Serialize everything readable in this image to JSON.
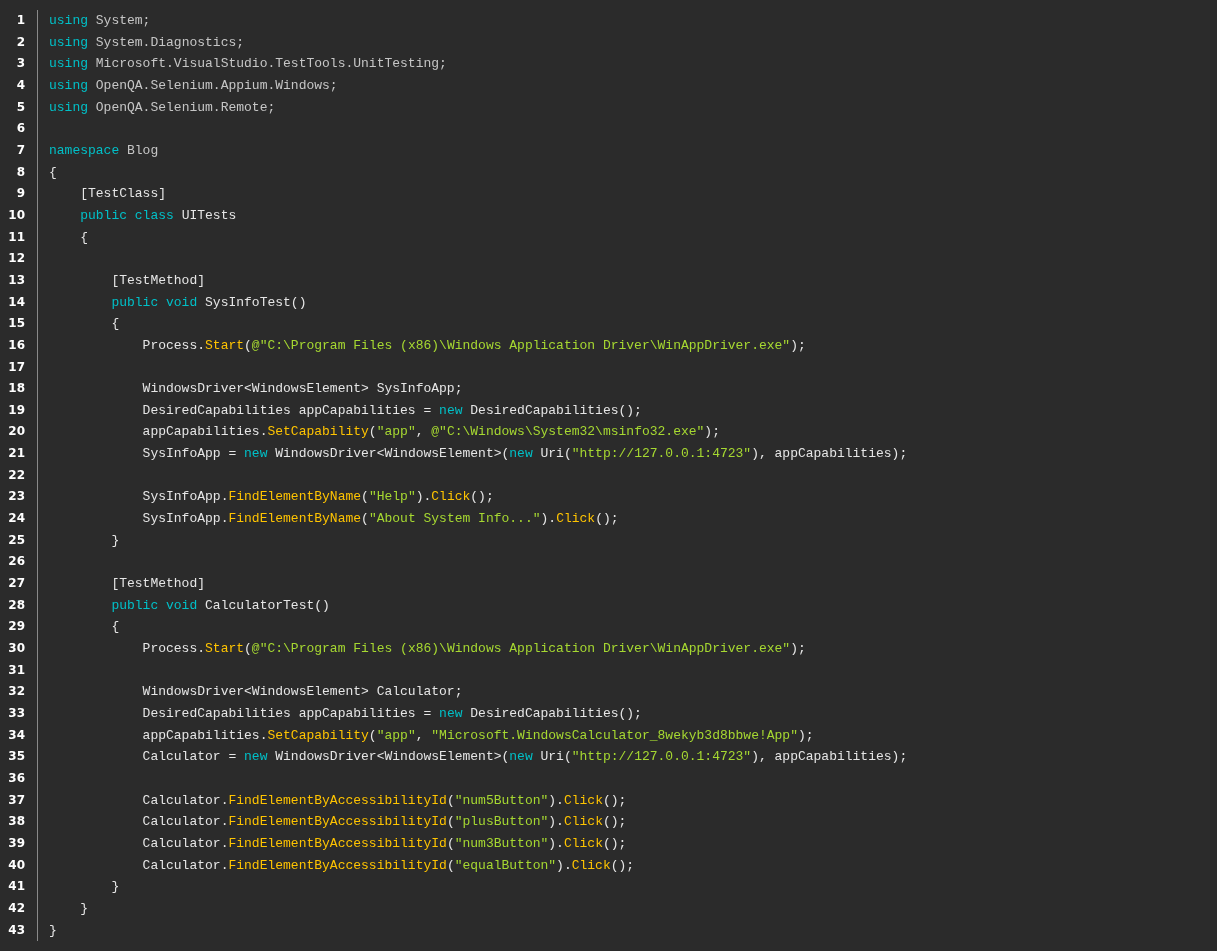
{
  "editor": {
    "lines": [
      {
        "number": "1",
        "tokens": [
          {
            "kind": "keyword",
            "text": "using"
          },
          {
            "kind": "name",
            "text": " System;"
          }
        ]
      },
      {
        "number": "2",
        "tokens": [
          {
            "kind": "keyword",
            "text": "using"
          },
          {
            "kind": "name",
            "text": " System.Diagnostics;"
          }
        ]
      },
      {
        "number": "3",
        "tokens": [
          {
            "kind": "keyword",
            "text": "using"
          },
          {
            "kind": "name",
            "text": " Microsoft.VisualStudio.TestTools.UnitTesting;"
          }
        ]
      },
      {
        "number": "4",
        "tokens": [
          {
            "kind": "keyword",
            "text": "using"
          },
          {
            "kind": "name",
            "text": " OpenQA.Selenium.Appium.Windows;"
          }
        ]
      },
      {
        "number": "5",
        "tokens": [
          {
            "kind": "keyword",
            "text": "using"
          },
          {
            "kind": "name",
            "text": " OpenQA.Selenium.Remote;"
          }
        ]
      },
      {
        "number": "6"
      },
      {
        "number": "7",
        "tokens": [
          {
            "kind": "keyword",
            "text": "namespace"
          },
          {
            "kind": "name",
            "text": " Blog"
          }
        ]
      },
      {
        "number": "8",
        "tokens": [
          {
            "kind": "text",
            "text": "{"
          }
        ]
      },
      {
        "number": "9",
        "tokens": [
          {
            "kind": "text",
            "text": "    [TestClass]"
          }
        ]
      },
      {
        "number": "10",
        "tokens": [
          {
            "kind": "keyword",
            "text": "    public class"
          },
          {
            "kind": "text",
            "text": " UITests"
          }
        ]
      },
      {
        "number": "11",
        "tokens": [
          {
            "kind": "text",
            "text": "    {"
          }
        ]
      },
      {
        "number": "12"
      },
      {
        "number": "13",
        "tokens": [
          {
            "kind": "text",
            "text": "        [TestMethod]"
          }
        ]
      },
      {
        "number": "14",
        "tokens": [
          {
            "kind": "keyword",
            "text": "        public void"
          },
          {
            "kind": "text",
            "text": " SysInfoTest()"
          }
        ]
      },
      {
        "number": "15",
        "tokens": [
          {
            "kind": "text",
            "text": "        {"
          }
        ]
      },
      {
        "number": "16",
        "tokens": [
          {
            "kind": "text",
            "text": "            Process."
          },
          {
            "kind": "method",
            "text": "Start"
          },
          {
            "kind": "text",
            "text": "("
          },
          {
            "kind": "string",
            "text": "@\"C:\\Program Files (x86)\\Windows Application Driver\\WinAppDriver.exe\""
          },
          {
            "kind": "text",
            "text": ");"
          }
        ]
      },
      {
        "number": "17"
      },
      {
        "number": "18",
        "tokens": [
          {
            "kind": "text",
            "text": "            WindowsDriver<WindowsElement> SysInfoApp;"
          }
        ]
      },
      {
        "number": "19",
        "tokens": [
          {
            "kind": "text",
            "text": "            DesiredCapabilities appCapabilities = "
          },
          {
            "kind": "keyword",
            "text": "new"
          },
          {
            "kind": "text",
            "text": " DesiredCapabilities();"
          }
        ]
      },
      {
        "number": "20",
        "tokens": [
          {
            "kind": "text",
            "text": "            appCapabilities."
          },
          {
            "kind": "method",
            "text": "SetCapability"
          },
          {
            "kind": "text",
            "text": "("
          },
          {
            "kind": "string",
            "text": "\"app\""
          },
          {
            "kind": "text",
            "text": ", "
          },
          {
            "kind": "string",
            "text": "@\"C:\\Windows\\System32\\msinfo32.exe\""
          },
          {
            "kind": "text",
            "text": ");"
          }
        ]
      },
      {
        "number": "21",
        "tokens": [
          {
            "kind": "text",
            "text": "            SysInfoApp = "
          },
          {
            "kind": "keyword",
            "text": "new"
          },
          {
            "kind": "text",
            "text": " WindowsDriver<WindowsElement>("
          },
          {
            "kind": "keyword",
            "text": "new"
          },
          {
            "kind": "text",
            "text": " Uri("
          },
          {
            "kind": "string",
            "text": "\"http://127.0.0.1:4723\""
          },
          {
            "kind": "text",
            "text": "), appCapabilities);"
          }
        ]
      },
      {
        "number": "22"
      },
      {
        "number": "23",
        "tokens": [
          {
            "kind": "text",
            "text": "            SysInfoApp."
          },
          {
            "kind": "method",
            "text": "FindElementByName"
          },
          {
            "kind": "text",
            "text": "("
          },
          {
            "kind": "string",
            "text": "\"Help\""
          },
          {
            "kind": "text",
            "text": ")."
          },
          {
            "kind": "method",
            "text": "Click"
          },
          {
            "kind": "text",
            "text": "();"
          }
        ]
      },
      {
        "number": "24",
        "tokens": [
          {
            "kind": "text",
            "text": "            SysInfoApp."
          },
          {
            "kind": "method",
            "text": "FindElementByName"
          },
          {
            "kind": "text",
            "text": "("
          },
          {
            "kind": "string",
            "text": "\"About System Info...\""
          },
          {
            "kind": "text",
            "text": ")."
          },
          {
            "kind": "method",
            "text": "Click"
          },
          {
            "kind": "text",
            "text": "();"
          }
        ]
      },
      {
        "number": "25",
        "tokens": [
          {
            "kind": "text",
            "text": "        }"
          }
        ]
      },
      {
        "number": "26"
      },
      {
        "number": "27",
        "tokens": [
          {
            "kind": "text",
            "text": "        [TestMethod]"
          }
        ]
      },
      {
        "number": "28",
        "tokens": [
          {
            "kind": "keyword",
            "text": "        public void"
          },
          {
            "kind": "text",
            "text": " CalculatorTest()"
          }
        ]
      },
      {
        "number": "29",
        "tokens": [
          {
            "kind": "text",
            "text": "        {"
          }
        ]
      },
      {
        "number": "30",
        "tokens": [
          {
            "kind": "text",
            "text": "            Process."
          },
          {
            "kind": "method",
            "text": "Start"
          },
          {
            "kind": "text",
            "text": "("
          },
          {
            "kind": "string",
            "text": "@\"C:\\Program Files (x86)\\Windows Application Driver\\WinAppDriver.exe\""
          },
          {
            "kind": "text",
            "text": ");"
          }
        ]
      },
      {
        "number": "31"
      },
      {
        "number": "32",
        "tokens": [
          {
            "kind": "text",
            "text": "            WindowsDriver<WindowsElement> Calculator;"
          }
        ]
      },
      {
        "number": "33",
        "tokens": [
          {
            "kind": "text",
            "text": "            DesiredCapabilities appCapabilities = "
          },
          {
            "kind": "keyword",
            "text": "new"
          },
          {
            "kind": "text",
            "text": " DesiredCapabilities();"
          }
        ]
      },
      {
        "number": "34",
        "tokens": [
          {
            "kind": "text",
            "text": "            appCapabilities."
          },
          {
            "kind": "method",
            "text": "SetCapability"
          },
          {
            "kind": "text",
            "text": "("
          },
          {
            "kind": "string",
            "text": "\"app\""
          },
          {
            "kind": "text",
            "text": ", "
          },
          {
            "kind": "string",
            "text": "\"Microsoft.WindowsCalculator_8wekyb3d8bbwe!App\""
          },
          {
            "kind": "text",
            "text": ");"
          }
        ]
      },
      {
        "number": "35",
        "tokens": [
          {
            "kind": "text",
            "text": "            Calculator = "
          },
          {
            "kind": "keyword",
            "text": "new"
          },
          {
            "kind": "text",
            "text": " WindowsDriver<WindowsElement>("
          },
          {
            "kind": "keyword",
            "text": "new"
          },
          {
            "kind": "text",
            "text": " Uri("
          },
          {
            "kind": "string",
            "text": "\"http://127.0.0.1:4723\""
          },
          {
            "kind": "text",
            "text": "), appCapabilities);"
          }
        ]
      },
      {
        "number": "36"
      },
      {
        "number": "37",
        "tokens": [
          {
            "kind": "text",
            "text": "            Calculator."
          },
          {
            "kind": "method",
            "text": "FindElementByAccessibilityId"
          },
          {
            "kind": "text",
            "text": "("
          },
          {
            "kind": "string",
            "text": "\"num5Button\""
          },
          {
            "kind": "text",
            "text": ")."
          },
          {
            "kind": "method",
            "text": "Click"
          },
          {
            "kind": "text",
            "text": "();"
          }
        ]
      },
      {
        "number": "38",
        "tokens": [
          {
            "kind": "text",
            "text": "            Calculator."
          },
          {
            "kind": "method",
            "text": "FindElementByAccessibilityId"
          },
          {
            "kind": "text",
            "text": "("
          },
          {
            "kind": "string",
            "text": "\"plusButton\""
          },
          {
            "kind": "text",
            "text": ")."
          },
          {
            "kind": "method",
            "text": "Click"
          },
          {
            "kind": "text",
            "text": "();"
          }
        ]
      },
      {
        "number": "39",
        "tokens": [
          {
            "kind": "text",
            "text": "            Calculator."
          },
          {
            "kind": "method",
            "text": "FindElementByAccessibilityId"
          },
          {
            "kind": "text",
            "text": "("
          },
          {
            "kind": "string",
            "text": "\"num3Button\""
          },
          {
            "kind": "text",
            "text": ")."
          },
          {
            "kind": "method",
            "text": "Click"
          },
          {
            "kind": "text",
            "text": "();"
          }
        ]
      },
      {
        "number": "40",
        "tokens": [
          {
            "kind": "text",
            "text": "            Calculator."
          },
          {
            "kind": "method",
            "text": "FindElementByAccessibilityId"
          },
          {
            "kind": "text",
            "text": "("
          },
          {
            "kind": "string",
            "text": "\"equalButton\""
          },
          {
            "kind": "text",
            "text": ")."
          },
          {
            "kind": "method",
            "text": "Click"
          },
          {
            "kind": "text",
            "text": "();"
          }
        ]
      },
      {
        "number": "41",
        "tokens": [
          {
            "kind": "text",
            "text": "        }"
          }
        ]
      },
      {
        "number": "42",
        "tokens": [
          {
            "kind": "text",
            "text": "    }"
          }
        ]
      },
      {
        "number": "43",
        "tokens": [
          {
            "kind": "text",
            "text": "}"
          }
        ]
      }
    ]
  }
}
